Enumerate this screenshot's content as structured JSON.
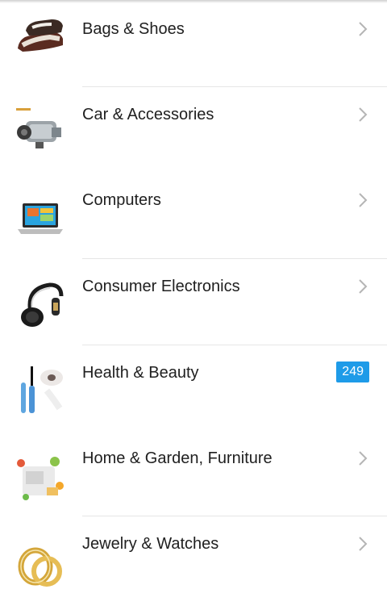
{
  "categories": [
    {
      "label": "Bags & Shoes",
      "icon": "shoes-icon",
      "trailing": "chevron"
    },
    {
      "label": "Car & Accessories",
      "icon": "car-compressor-icon",
      "trailing": "chevron"
    },
    {
      "label": "Computers",
      "icon": "laptop-icon",
      "trailing": "chevron"
    },
    {
      "label": "Consumer Electronics",
      "icon": "headphones-icon",
      "trailing": "chevron"
    },
    {
      "label": "Health & Beauty",
      "icon": "mascara-icon",
      "trailing": "badge",
      "badge": "249"
    },
    {
      "label": "Home & Garden, Furniture",
      "icon": "home-garden-icon",
      "trailing": "chevron"
    },
    {
      "label": "Jewelry & Watches",
      "icon": "rings-icon",
      "trailing": "chevron"
    }
  ],
  "colors": {
    "badge": "#1e9be8",
    "divider": "#e6e6e6",
    "chevron": "#b5b5b5",
    "text": "#202020"
  }
}
